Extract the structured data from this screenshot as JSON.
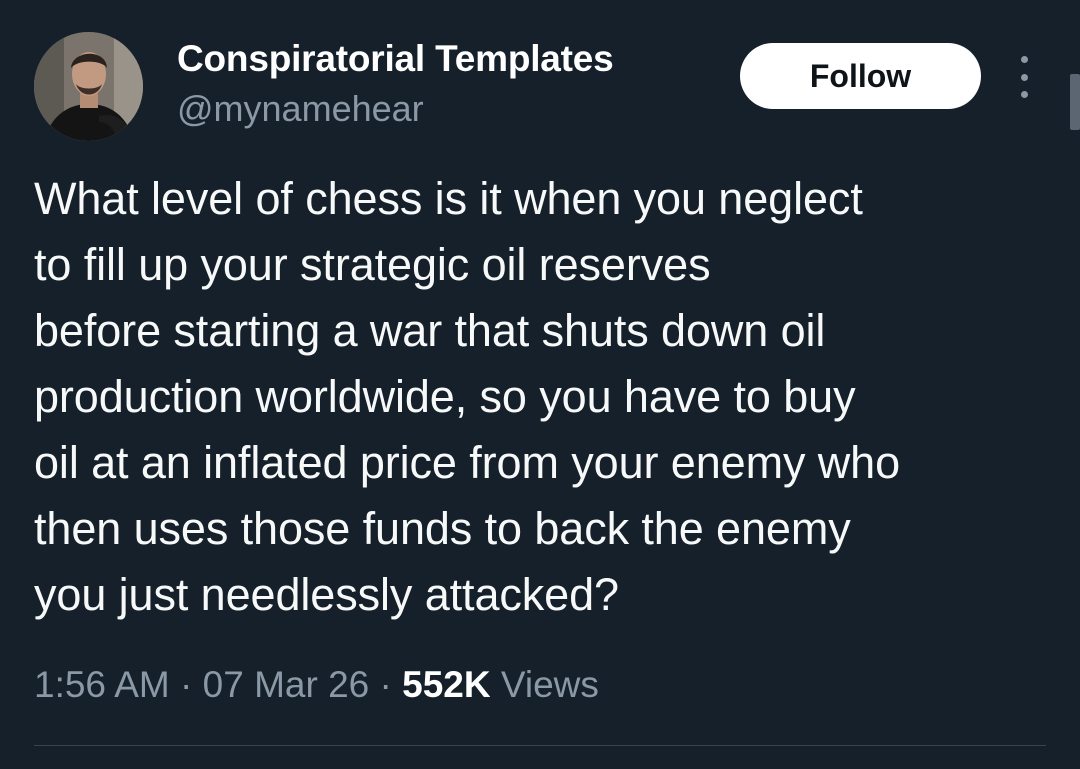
{
  "author": {
    "name": "Conspiratorial Templates",
    "handle": "@mynamehear"
  },
  "actions": {
    "follow_label": "Follow",
    "more_icon": "more-vertical-icon"
  },
  "tweet": {
    "text": "What level of chess is it when you neglect\nto fill up your strategic oil reserves\nbefore starting a war that shuts down oil\nproduction worldwide, so you have to buy\noil at an inflated price from your enemy who\nthen uses those funds to back the enemy\nyou just needlessly attacked?",
    "time": "1:56 AM",
    "date": "07 Mar 26",
    "separator": "·",
    "views_count": "552K",
    "views_label": "Views"
  },
  "colors": {
    "background": "#15202b",
    "secondary_text": "#8b98a5",
    "follow_bg": "#ffffff"
  }
}
